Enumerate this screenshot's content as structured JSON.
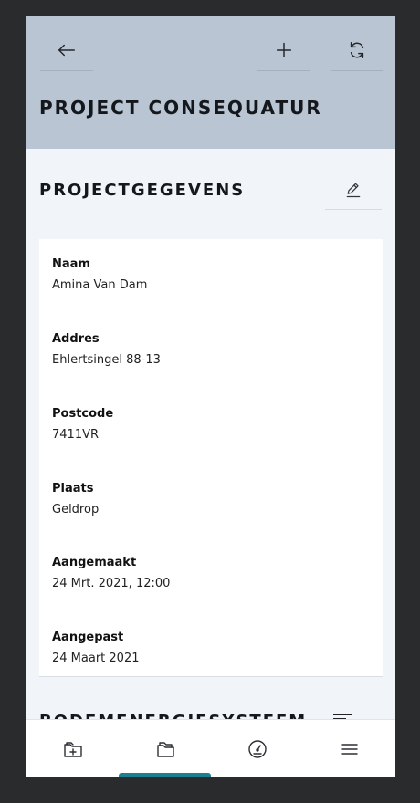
{
  "header": {
    "title": "PROJECT CONSEQUATUR",
    "back_icon": "arrow-left-icon",
    "add_icon": "plus-icon",
    "refresh_icon": "refresh-icon"
  },
  "section": {
    "title": "PROJECTGEGEVENS",
    "edit_icon": "pencil-icon"
  },
  "fields": [
    {
      "label": "Naam",
      "value": "Amina Van Dam"
    },
    {
      "label": "Addres",
      "value": "Ehlertsingel 88-13"
    },
    {
      "label": "Postcode",
      "value": "7411VR"
    },
    {
      "label": "Plaats",
      "value": "Geldrop"
    },
    {
      "label": "Aangemaakt",
      "value": "24 Mrt. 2021, 12:00"
    },
    {
      "label": "Aangepast",
      "value": "24 Maart 2021"
    }
  ],
  "next_section": {
    "title": "BODEMENERGIESYSTEEM",
    "sort_icon": "sort-icon"
  },
  "bottom_nav": {
    "items": [
      "folder-add-icon",
      "folders-icon",
      "gauge-icon",
      "menu-icon"
    ],
    "active_index": 1,
    "accent": "#1d7f90"
  }
}
